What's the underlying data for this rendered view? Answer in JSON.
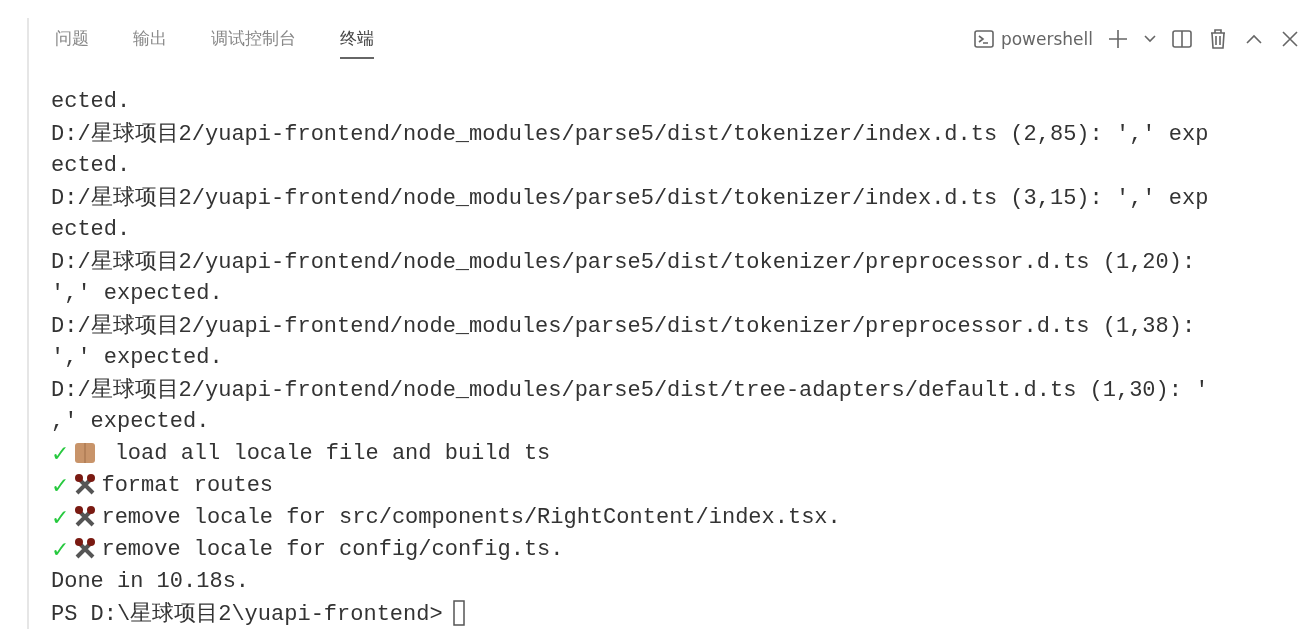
{
  "panel_tabs": [
    {
      "label": "问题",
      "selected": false
    },
    {
      "label": "输出",
      "selected": false
    },
    {
      "label": "调试控制台",
      "selected": false
    },
    {
      "label": "终端",
      "selected": true
    }
  ],
  "terminal_picker": {
    "label": "powershell"
  },
  "terminal_lines": [
    {
      "kind": "text",
      "text": "ected."
    },
    {
      "kind": "text",
      "text": "D:/星球项目2/yuapi-frontend/node_modules/parse5/dist/tokenizer/index.d.ts (2,85): ',' exp"
    },
    {
      "kind": "text",
      "text": "ected."
    },
    {
      "kind": "text",
      "text": "D:/星球项目2/yuapi-frontend/node_modules/parse5/dist/tokenizer/index.d.ts (3,15): ',' exp"
    },
    {
      "kind": "text",
      "text": "ected."
    },
    {
      "kind": "text",
      "text": "D:/星球项目2/yuapi-frontend/node_modules/parse5/dist/tokenizer/preprocessor.d.ts (1,20):"
    },
    {
      "kind": "text",
      "text": "',' expected."
    },
    {
      "kind": "text",
      "text": "D:/星球项目2/yuapi-frontend/node_modules/parse5/dist/tokenizer/preprocessor.d.ts (1,38):"
    },
    {
      "kind": "text",
      "text": "',' expected."
    },
    {
      "kind": "text",
      "text": "D:/星球项目2/yuapi-frontend/node_modules/parse5/dist/tree-adapters/default.d.ts (1,30): '"
    },
    {
      "kind": "text",
      "text": ",' expected."
    },
    {
      "kind": "box-task",
      "check": "✓",
      "text": " load all locale file and build ts"
    },
    {
      "kind": "tool-task",
      "check": "✓",
      "text": "format routes"
    },
    {
      "kind": "tool-task",
      "check": "✓",
      "text": "remove locale for src/components/RightContent/index.tsx."
    },
    {
      "kind": "tool-task",
      "check": "✓",
      "text": "remove locale for config/config.ts."
    },
    {
      "kind": "text",
      "text": "Done in 10.18s."
    },
    {
      "kind": "prompt",
      "text": "PS D:\\星球项目2\\yuapi-frontend>"
    }
  ]
}
